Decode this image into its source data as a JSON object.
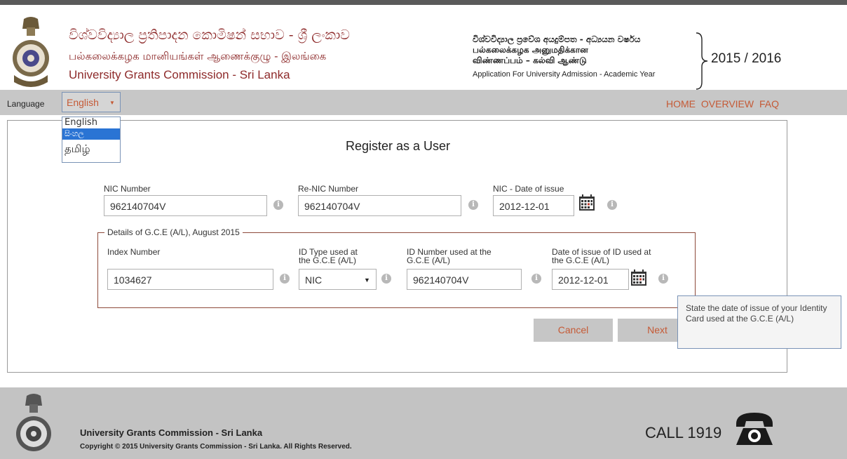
{
  "header": {
    "title_si": "විශ්වවිද්‍යාල ප්‍රතිපාදන කොමිෂන් සභාව - ශ්‍රී ලංකාව",
    "title_ta": "பல்கலைக்கழக மானியங்கள் ஆணைக்குழு - இலங்கை",
    "title_en": "University Grants Commission - Sri Lanka",
    "right_si": "විශ්වවිද්‍යාල ප්‍රවේශ අයදුම්පත - අධ්‍යයන වර්ෂය",
    "right_ta1": "பல்கலைக்கழக அனுமதிக்கான",
    "right_ta2": "விண்ணப்பம் – கல்வி ஆண்டு",
    "right_en": "Application For University Admission - Academic Year",
    "year": "2015 / 2016"
  },
  "nav": {
    "language_label": "Language",
    "language_value": "English",
    "language_options": [
      "English",
      "සිංහල",
      "தமிழ்"
    ],
    "links": [
      "HOME",
      "OVERVIEW",
      "FAQ"
    ]
  },
  "form": {
    "title": "Register as a User",
    "nic_label": "NIC Number",
    "nic_value": "962140704V",
    "renic_label": "Re-NIC Number",
    "renic_value": "962140704V",
    "nic_date_label": "NIC - Date of issue",
    "nic_date_value": "2012-12-01",
    "legend": "Details of G.C.E (A/L), August 2015",
    "index_label": "Index Number",
    "index_value": "1034627",
    "idtype_label1": "ID Type used at",
    "idtype_label2": "the G.C.E (A/L)",
    "idtype_value": "NIC",
    "idnum_label1": "ID Number used at the",
    "idnum_label2": "G.C.E (A/L)",
    "idnum_value": "962140704V",
    "iddate_label1": "Date of issue of ID used at",
    "iddate_label2": "the G.C.E (A/L)",
    "iddate_value": "2012-12-01",
    "cancel_label": "Cancel",
    "next_label": "Next",
    "tooltip": "State the date of issue of your Identity Card used at the G.C.E (A/L)"
  },
  "footer": {
    "org": "University Grants Commission - Sri Lanka",
    "copyright": "Copyright © 2015 University Grants Commission - Sri Lanka. All Rights Reserved.",
    "call": "CALL 1919"
  },
  "colors": {
    "accent": "#c55a36",
    "title_red": "#8e2b2b",
    "nav_grey": "#c7c7c7",
    "selected_blue": "#2a74d4"
  },
  "icons": [
    "emblem-logo",
    "info-icon",
    "calendar-icon",
    "phone-icon",
    "chevron-down-icon"
  ]
}
